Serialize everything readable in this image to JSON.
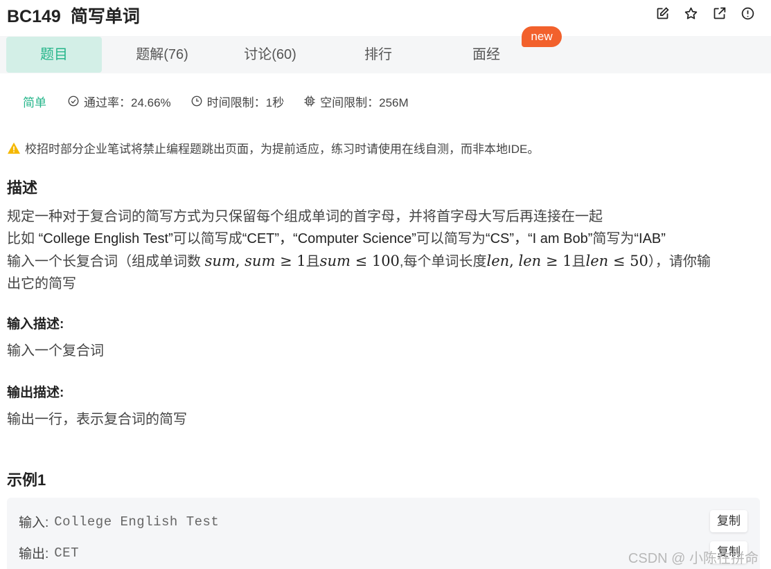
{
  "header": {
    "problem_id": "BC149",
    "problem_title": "简写单词",
    "icons": [
      "edit-icon",
      "star-icon",
      "external-link-icon",
      "report-icon"
    ]
  },
  "tabs": [
    {
      "label": "题目",
      "active": true
    },
    {
      "label": "题解(76)",
      "active": false
    },
    {
      "label": "讨论(60)",
      "active": false
    },
    {
      "label": "排行",
      "active": false
    },
    {
      "label": "面经",
      "active": false
    }
  ],
  "new_badge": "new",
  "meta": {
    "difficulty": "简单",
    "pass_rate": "通过率：24.66%",
    "time_limit": "时间限制：1秒",
    "space_limit": "空间限制：256M"
  },
  "warning": "校招时部分企业笔试将禁止编程题跳出页面，为提前适应，练习时请使用在线自测，而非本地IDE。",
  "description": {
    "heading": "描述",
    "line1": "规定一种对于复合词的简写方式为只保留每个组成单词的首字母，并将首字母大写后再连接在一起",
    "line2": {
      "p1": "比如 ",
      "e1": "“College English Test”",
      "p2": "可以简写成",
      "e2": "“CET”，“Computer Science”",
      "p3": "可以简写为",
      "e3": "“CS”，“I am Bob”",
      "p4": "简写为",
      "e4": "“IAB”"
    },
    "line3": {
      "p1": "输入一个长复合词（组成单词数 ",
      "m1": "sum",
      "m2": ", ",
      "m3": "sum",
      "m4": " ≥ 1",
      "p2": "且",
      "m5": "sum",
      "m6": " ≤ 100",
      "p3": ",每个单词长度",
      "m7": "len",
      "m8": ", ",
      "m9": "len",
      "m10": " ≥ 1",
      "p4": "且",
      "m11": "len",
      "m12": " ≤ 50",
      "p5": "），请你输"
    },
    "line4": "出它的简写"
  },
  "input_desc": {
    "heading": "输入描述:",
    "text": "输入一个复合词"
  },
  "output_desc": {
    "heading": "输出描述:",
    "text": "输出一行，表示复合词的简写"
  },
  "example": {
    "heading": "示例1",
    "input_label": "输入:",
    "input_value": "College English Test",
    "output_label": "输出:",
    "output_value": "CET",
    "copy_label": "复制"
  },
  "watermark": "CSDN @ 小陈在拼命",
  "colors": {
    "accent": "#25b58a",
    "active_tab_bg": "#d3efe7",
    "badge": "#f2612c",
    "warning_icon": "#f5b800"
  }
}
